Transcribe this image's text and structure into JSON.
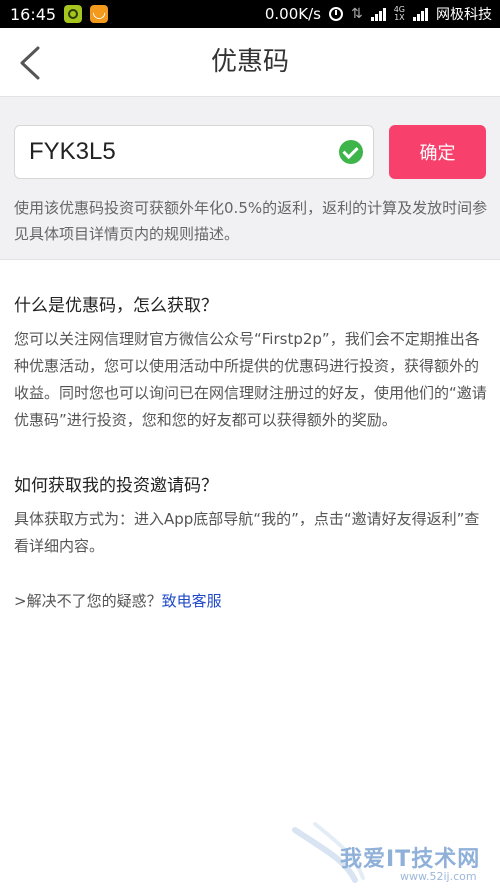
{
  "status_bar": {
    "time": "16:45",
    "speed": "0.00K/s",
    "network_type": "4G",
    "network_sub": "1X",
    "carrier": "网极科技"
  },
  "nav": {
    "title": "优惠码"
  },
  "code_box": {
    "value": "FYK3L5",
    "confirm_label": "确定",
    "description": "使用该优惠码投资可获额外年化0.5%的返利，返利的计算及发放时间参见具体项目详情页内的规则描述。"
  },
  "faq": [
    {
      "title": "什么是优惠码，怎么获取？",
      "body": "您可以关注网信理财官方微信公众号“Firstp2p”，我们会不定期推出各种优惠活动，您可以使用活动中所提供的优惠码进行投资，获得额外的收益。同时您也可以询问已在网信理财注册过的好友，使用他们的“邀请优惠码”进行投资，您和您的好友都可以获得额外的奖励。"
    },
    {
      "title": "如何获取我的投资邀请码？",
      "body": "具体获取方式为：进入App底部导航“我的”，点击“邀请好友得返利”查看详细内容。"
    }
  ],
  "help": {
    "prefix": ">解决不了您的疑惑？",
    "link_label": "致电客服"
  },
  "watermark": {
    "text": "我爱IT技术网",
    "url": "www.52ij.com"
  },
  "colors": {
    "accent": "#f7416c",
    "success": "#3db54a",
    "link": "#1f49c8"
  }
}
